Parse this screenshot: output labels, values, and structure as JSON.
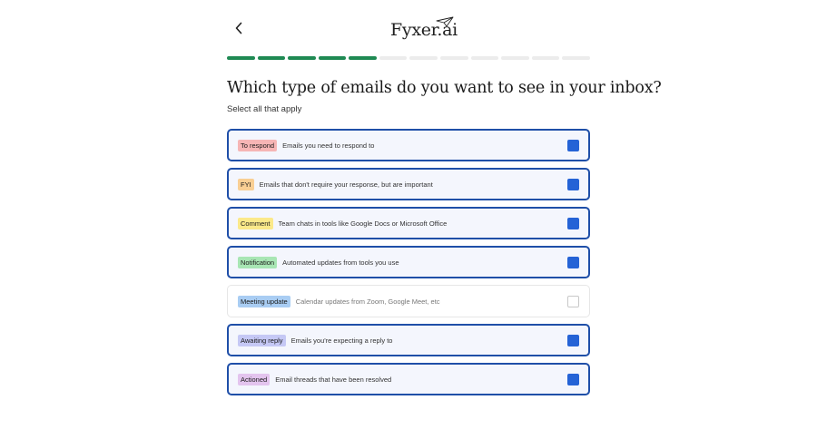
{
  "header": {
    "back_icon": "chevron-left-icon",
    "logo_text": "Fyxer.ai",
    "logo_icon": "paper-plane-icon"
  },
  "progress": {
    "total_steps": 12,
    "completed_steps": 5,
    "color_done": "#1f8a53",
    "color_pending": "#ececec"
  },
  "question": {
    "title": "Which type of emails do you want to see in your inbox?",
    "subtitle": "Select all that apply"
  },
  "options": [
    {
      "tag": "To respond",
      "tag_color": "#f6b5b5",
      "description": "Emails you need to respond to",
      "checked": true
    },
    {
      "tag": "FYI",
      "tag_color": "#f9cf94",
      "description": "Emails that don't require your response, but are important",
      "checked": true
    },
    {
      "tag": "Comment",
      "tag_color": "#fbe98a",
      "description": "Team chats in tools like Google Docs or Microsoft Office",
      "checked": true
    },
    {
      "tag": "Notification",
      "tag_color": "#a8e6b4",
      "description": "Automated updates from tools you use",
      "checked": true
    },
    {
      "tag": "Meeting update",
      "tag_color": "#a9cdf3",
      "description": "Calendar updates from Zoom, Google Meet, etc",
      "checked": false
    },
    {
      "tag": "Awaiting reply",
      "tag_color": "#c5c8f5",
      "description": "Emails you're expecting a reply to",
      "checked": true
    },
    {
      "tag": "Actioned",
      "tag_color": "#e3c4ee",
      "description": "Email threads that have been resolved",
      "checked": true
    }
  ],
  "colors": {
    "selected_border": "#1f4fa8",
    "selected_background": "#f4f6fd",
    "checkbox_checked": "#2563d6"
  }
}
